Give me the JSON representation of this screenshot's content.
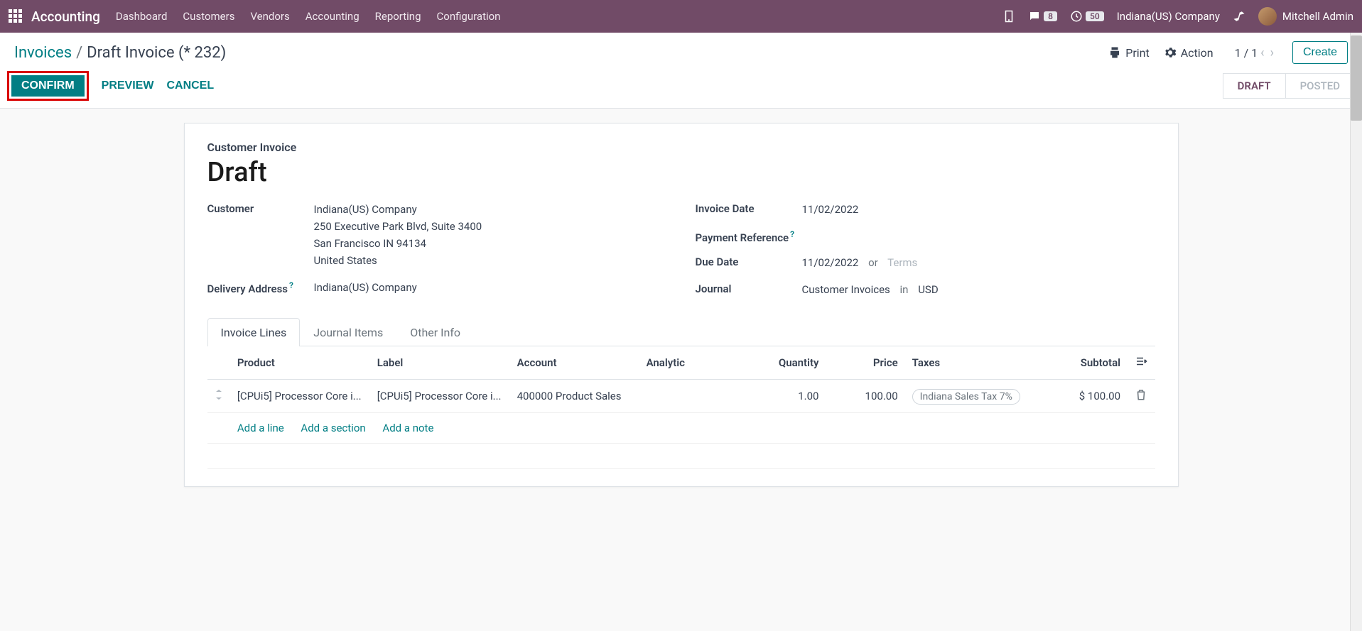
{
  "topnav": {
    "app_title": "Accounting",
    "menus": [
      "Dashboard",
      "Customers",
      "Vendors",
      "Accounting",
      "Reporting",
      "Configuration"
    ],
    "messaging_count": "8",
    "activities_count": "50",
    "company": "Indiana(US) Company",
    "user": "Mitchell Admin"
  },
  "breadcrumb": {
    "parent": "Invoices",
    "current": "Draft Invoice (* 232)",
    "print": "Print",
    "action": "Action",
    "pager": "1 / 1",
    "create": "Create"
  },
  "actions": {
    "confirm": "CONFIRM",
    "preview": "PREVIEW",
    "cancel": "CANCEL"
  },
  "status": {
    "draft": "DRAFT",
    "posted": "POSTED"
  },
  "form": {
    "type_label": "Customer Invoice",
    "title": "Draft",
    "customer_label": "Customer",
    "customer_name": "Indiana(US) Company",
    "customer_addr1": "250 Executive Park Blvd, Suite 3400",
    "customer_addr2": "San Francisco IN 94134",
    "customer_addr3": "United States",
    "delivery_label": "Delivery Address",
    "delivery_val": "Indiana(US) Company",
    "invoice_date_label": "Invoice Date",
    "invoice_date_val": "11/02/2022",
    "payref_label": "Payment Reference",
    "due_label": "Due Date",
    "due_val": "11/02/2022",
    "or_label": "or",
    "terms_placeholder": "Terms",
    "journal_label": "Journal",
    "journal_val": "Customer Invoices",
    "in_label": "in",
    "currency": "USD"
  },
  "tabs": {
    "lines": "Invoice Lines",
    "journal": "Journal Items",
    "other": "Other Info"
  },
  "table": {
    "headers": {
      "product": "Product",
      "label": "Label",
      "account": "Account",
      "analytic": "Analytic",
      "quantity": "Quantity",
      "price": "Price",
      "taxes": "Taxes",
      "subtotal": "Subtotal"
    },
    "rows": [
      {
        "product": "[CPUi5] Processor Core i...",
        "label": "[CPUi5] Processor Core i...",
        "account": "400000 Product Sales",
        "analytic": "",
        "quantity": "1.00",
        "price": "100.00",
        "tax": "Indiana Sales Tax 7%",
        "subtotal": "$ 100.00"
      }
    ],
    "add_line": "Add a line",
    "add_section": "Add a section",
    "add_note": "Add a note"
  }
}
